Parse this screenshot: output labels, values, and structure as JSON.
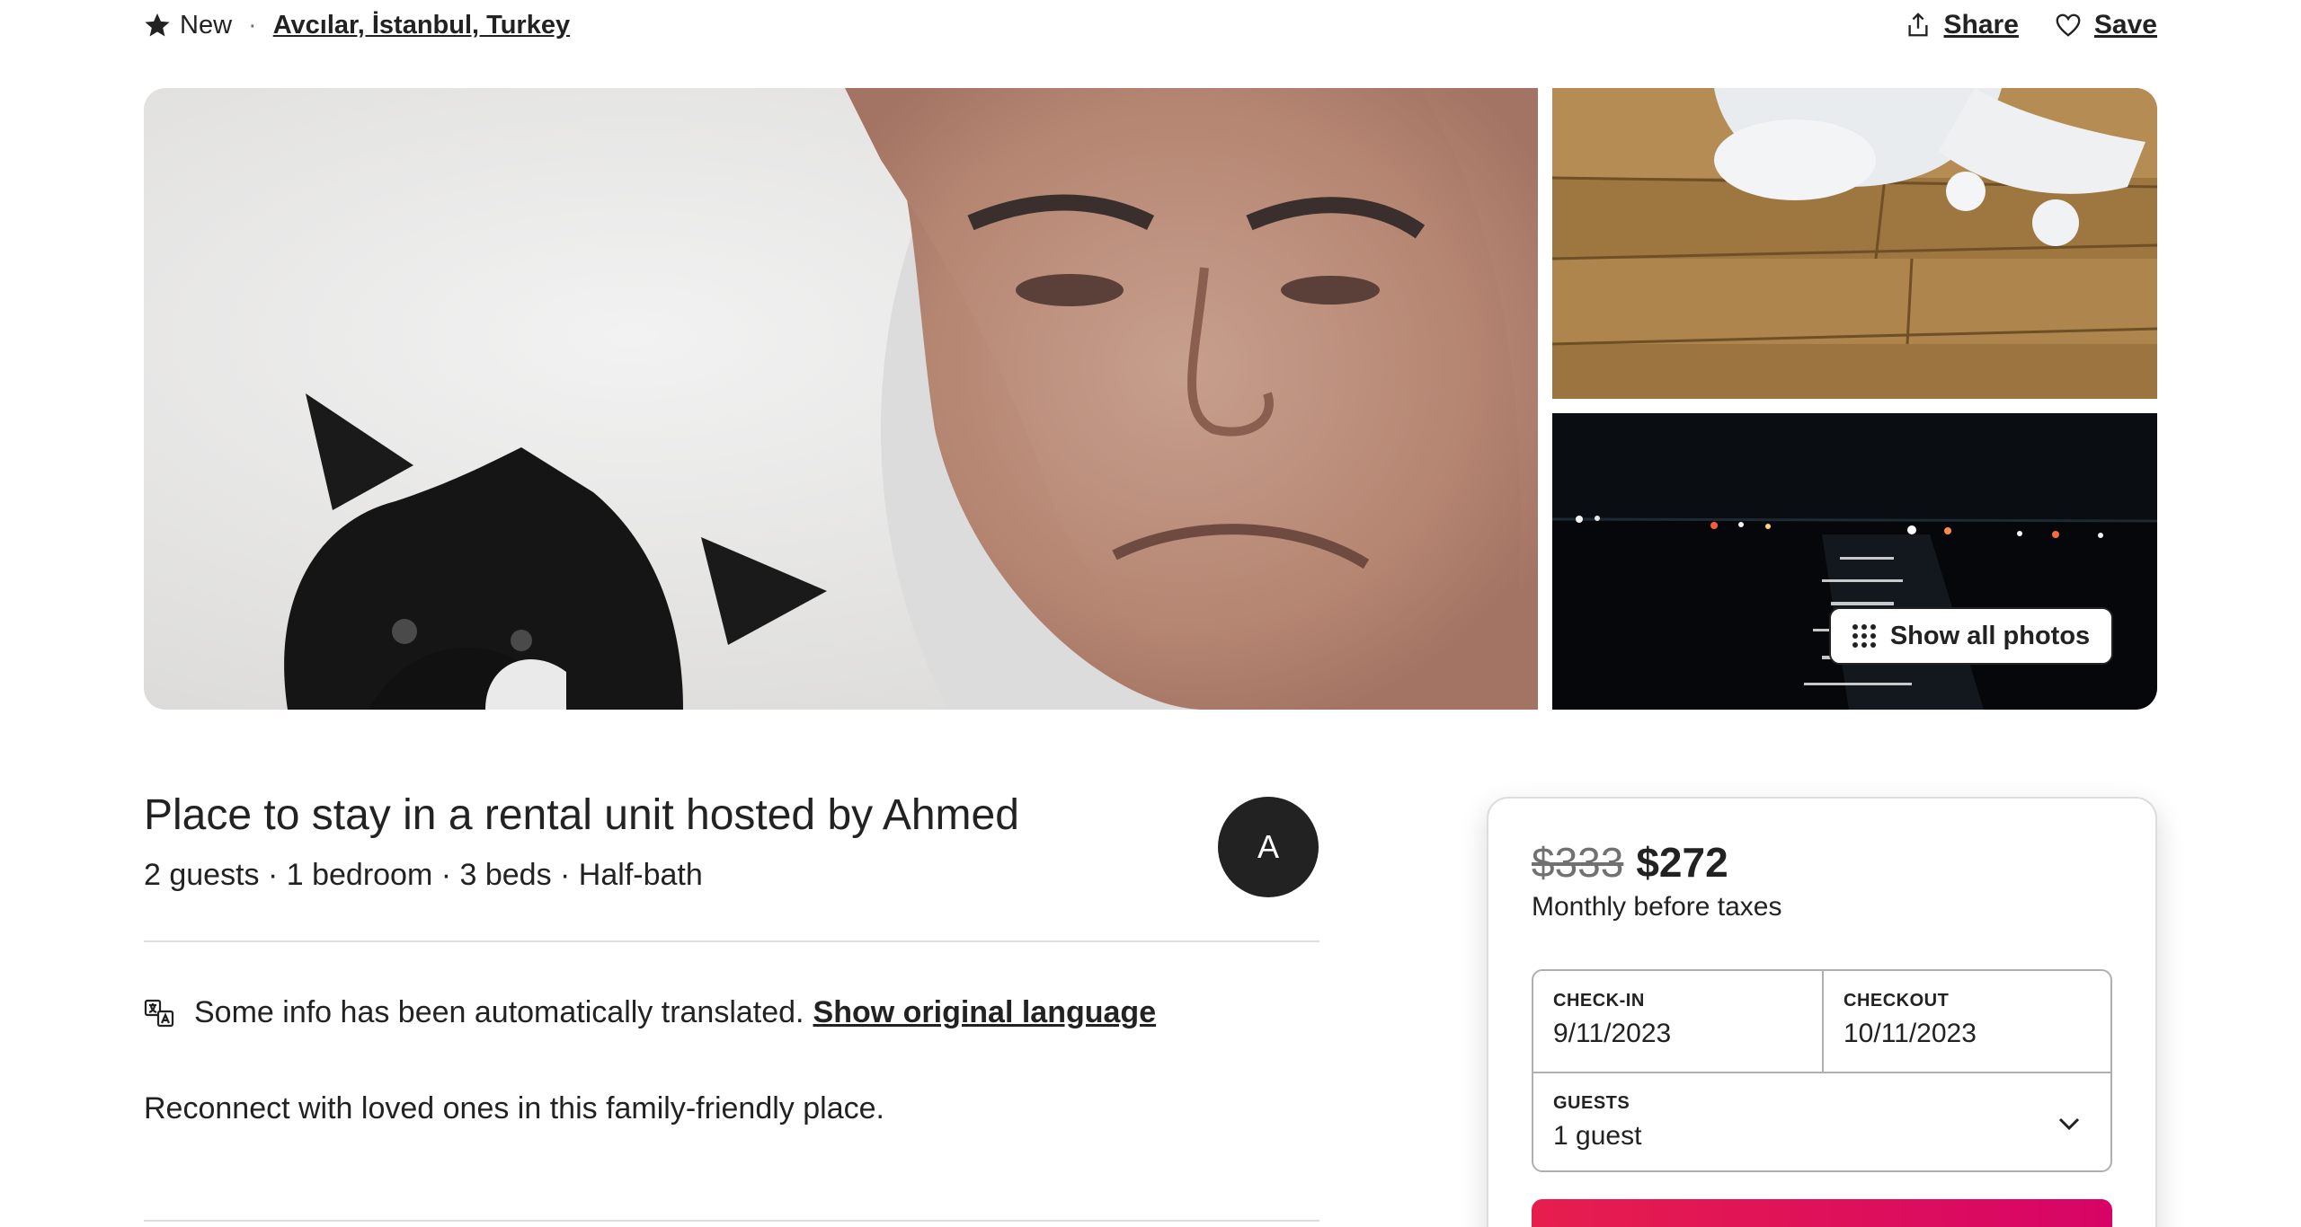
{
  "header": {
    "rating_label": "New",
    "separator": "·",
    "location": "Avcılar, İstanbul, Turkey",
    "share_label": "Share",
    "save_label": "Save"
  },
  "photos": {
    "show_all_label": "Show all photos"
  },
  "listing": {
    "title": "Place to stay in a rental unit hosted by Ahmed",
    "details": "2 guests · 1 bedroom · 3 beds · Half-bath",
    "host_initial": "A",
    "translation_notice": "Some info has been automatically translated.",
    "show_original_label": "Show original language",
    "description": "Reconnect with loved ones in this family-friendly place."
  },
  "booking": {
    "old_price": "$333",
    "new_price": "$272",
    "price_note": "Monthly before taxes",
    "checkin_label": "CHECK-IN",
    "checkin_value": "9/11/2023",
    "checkout_label": "CHECKOUT",
    "checkout_value": "10/11/2023",
    "guests_label": "GUESTS",
    "guests_value": "1 guest"
  },
  "icons": {
    "rating": "star-icon",
    "share": "share-icon",
    "save": "heart-icon",
    "grid": "grid-icon",
    "translate": "translate-icon",
    "dropdown": "chevron-down-icon"
  },
  "colors": {
    "text": "#222222",
    "muted": "#717171",
    "divider": "#dddddd",
    "brand": "#e61e4d"
  }
}
